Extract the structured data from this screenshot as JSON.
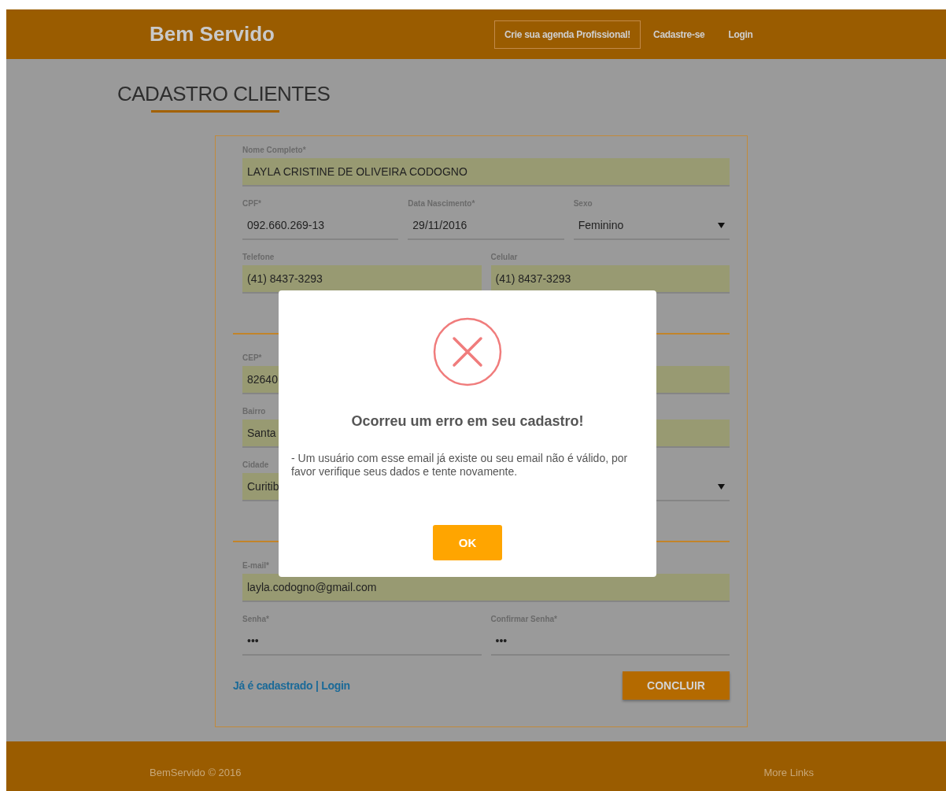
{
  "header": {
    "logo": "Bem Servido",
    "nav": [
      {
        "kind": "outlined",
        "label": "Crie sua agenda Profissional!"
      },
      {
        "kind": "link",
        "label": "Cadastre-se"
      },
      {
        "kind": "link",
        "label": "Login"
      }
    ]
  },
  "page_title": "CADASTRO CLIENTES",
  "form": {
    "sections": [
      {
        "rows": [
          [
            {
              "label": "Nome Completo*",
              "value": "LAYLA CRISTINE DE OLIVEIRA CODOGNO",
              "kind": "text",
              "filled": true
            }
          ],
          [
            {
              "label": "CPF*",
              "value": "092.660.269-13",
              "kind": "text",
              "filled": false
            },
            {
              "label": "Data Nascimento*",
              "value": "29/11/2016",
              "kind": "text",
              "filled": false
            },
            {
              "label": "Sexo",
              "value": "Feminino",
              "kind": "select",
              "filled": false
            }
          ],
          [
            {
              "label": "Telefone",
              "value": "(41) 8437-3293",
              "kind": "text",
              "filled": true
            },
            {
              "label": "Celular",
              "value": "(41) 8437-3293",
              "kind": "text",
              "filled": true
            }
          ]
        ]
      },
      {
        "rows": [
          [
            {
              "label": "CEP*",
              "value": "82640",
              "kind": "text",
              "filled": true
            }
          ],
          [
            {
              "label": "Bairro",
              "value": "Santa",
              "kind": "text",
              "filled": true
            }
          ],
          [
            {
              "label": "Cidade",
              "value": "Curitib",
              "kind": "text",
              "filled": true
            },
            {
              "kind": "select",
              "filled": false
            }
          ]
        ]
      },
      {
        "rows": [
          [
            {
              "label": "E-mail*",
              "value": "layla.codogno@gmail.com",
              "kind": "text",
              "filled": true
            }
          ],
          [
            {
              "label": "Senha*",
              "value": "•••",
              "kind": "text",
              "filled": false
            },
            {
              "label": "Confirmar Senha*",
              "value": "•••",
              "kind": "text",
              "filled": false
            }
          ]
        ]
      }
    ],
    "login_link": "Já é cadastrado | Login",
    "submit": "CONCLUIR"
  },
  "dialog": {
    "title": "Ocorreu um erro em seu cadastro!",
    "message": "- Um usuário com esse email já existe ou seu email não é válido, por favor verifique seus dados e tente novamente.",
    "button": "OK"
  },
  "footer": {
    "copyright": "BemServido © 2016",
    "links": "More Links"
  }
}
